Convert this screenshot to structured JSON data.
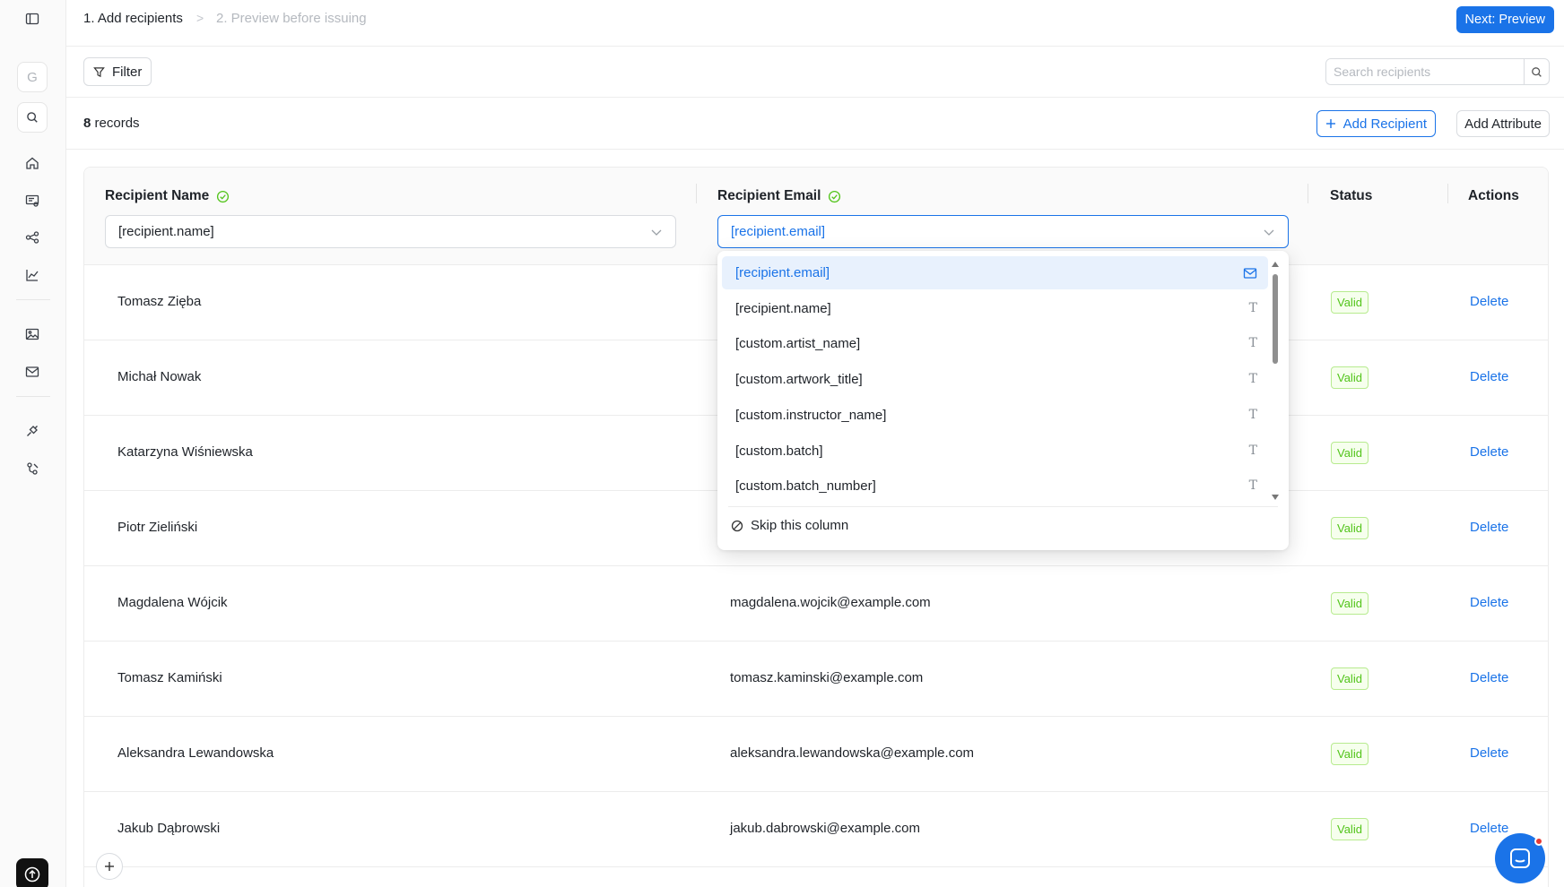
{
  "sidebar": {
    "avatar_letter": "G",
    "icons": [
      "panel-toggle-icon",
      "search-icon",
      "home-icon",
      "certificates-icon",
      "workflow-icon",
      "analytics-icon",
      "image-icon",
      "mail-icon",
      "integration-icon",
      "developer-icon",
      "upload-icon"
    ]
  },
  "header": {
    "step1": "1. Add recipients",
    "separator": ">",
    "step2": "2. Preview before issuing",
    "next_button": "Next: Preview"
  },
  "toolbar": {
    "filter_label": "Filter",
    "search_placeholder": "Search recipients"
  },
  "records": {
    "count": "8",
    "label": "records",
    "add_recipient": "Add Recipient",
    "add_attribute": "Add Attribute"
  },
  "table": {
    "columns": {
      "name": "Recipient Name",
      "email": "Recipient Email",
      "status": "Status",
      "actions": "Actions"
    },
    "name_mapping": "[recipient.name]",
    "email_mapping": "[recipient.email]",
    "rows": [
      {
        "name": "Tomasz Zięba",
        "email": "",
        "status": "Valid",
        "action": "Delete"
      },
      {
        "name": "Michał Nowak",
        "email": "",
        "status": "Valid",
        "action": "Delete"
      },
      {
        "name": "Katarzyna Wiśniewska",
        "email": "",
        "status": "Valid",
        "action": "Delete"
      },
      {
        "name": "Piotr Zieliński",
        "email": "",
        "status": "Valid",
        "action": "Delete"
      },
      {
        "name": "Magdalena Wójcik",
        "email": "magdalena.wojcik@example.com",
        "status": "Valid",
        "action": "Delete"
      },
      {
        "name": "Tomasz Kamiński",
        "email": "tomasz.kaminski@example.com",
        "status": "Valid",
        "action": "Delete"
      },
      {
        "name": "Aleksandra Lewandowska",
        "email": "aleksandra.lewandowska@example.com",
        "status": "Valid",
        "action": "Delete"
      },
      {
        "name": "Jakub Dąbrowski",
        "email": "jakub.dabrowski@example.com",
        "status": "Valid",
        "action": "Delete"
      }
    ]
  },
  "dropdown": {
    "options": [
      {
        "label": "[recipient.email]",
        "icon": "mail-icon",
        "glyph": "",
        "selected": true
      },
      {
        "label": "[recipient.name]",
        "icon": "text-type-icon",
        "glyph": "T",
        "selected": false
      },
      {
        "label": "[custom.artist_name]",
        "icon": "text-type-icon",
        "glyph": "T",
        "selected": false
      },
      {
        "label": "[custom.artwork_title]",
        "icon": "text-type-icon",
        "glyph": "T",
        "selected": false
      },
      {
        "label": "[custom.instructor_name]",
        "icon": "text-type-icon",
        "glyph": "T",
        "selected": false
      },
      {
        "label": "[custom.batch]",
        "icon": "text-type-icon",
        "glyph": "T",
        "selected": false
      },
      {
        "label": "[custom.batch_number]",
        "icon": "text-type-icon",
        "glyph": "T",
        "selected": false
      }
    ],
    "skip_label": "Skip this column"
  },
  "colors": {
    "accent": "#1a73e8",
    "valid_text": "#52c41a",
    "valid_bg": "#f6ffed",
    "valid_border": "#b7eb8f",
    "chat_badge": "#e53935"
  }
}
